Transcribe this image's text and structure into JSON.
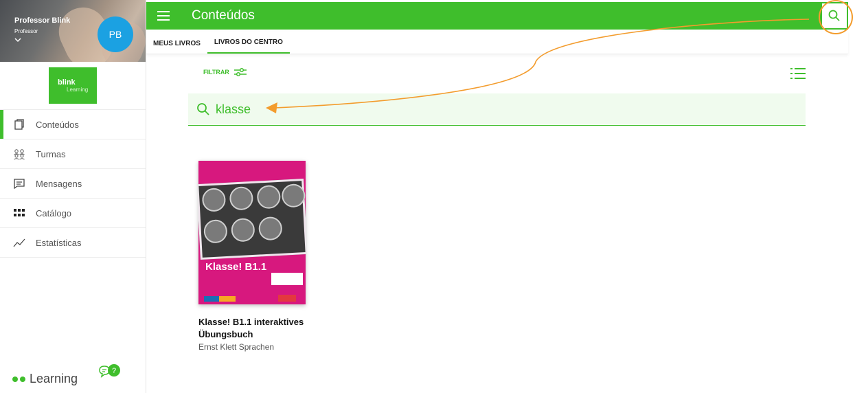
{
  "sidebar": {
    "user_name": "Professor Blink",
    "user_role": "Professor",
    "avatar_initials": "PB",
    "logo_main": "blink",
    "logo_sub": "Learning",
    "items": [
      {
        "label": "Conteúdos",
        "icon": "book-icon",
        "active": true
      },
      {
        "label": "Turmas",
        "icon": "group-icon"
      },
      {
        "label": "Mensagens",
        "icon": "message-icon"
      },
      {
        "label": "Catálogo",
        "icon": "grid-icon"
      },
      {
        "label": "Estatísticas",
        "icon": "stats-icon"
      }
    ],
    "footer_brand": "Learning"
  },
  "header": {
    "title": "Conteúdos",
    "search_icon": "search-icon"
  },
  "tabs": [
    {
      "label": "MEUS LIVROS",
      "active": false
    },
    {
      "label": "LIVROS DO CENTRO",
      "active": true
    }
  ],
  "filter": {
    "label": "FILTRAR"
  },
  "search": {
    "value": "klasse"
  },
  "books": [
    {
      "title": "Klasse! B1.1 interaktives Übungsbuch",
      "author": "Ernst Klett Sprachen",
      "cover_title": "Klasse! B1.1"
    }
  ],
  "colors": {
    "brand_green": "#3fbe2c",
    "avatar_blue": "#1ba1e2",
    "annotation_orange": "#f39c2d",
    "cover_magenta": "#d7187e"
  }
}
